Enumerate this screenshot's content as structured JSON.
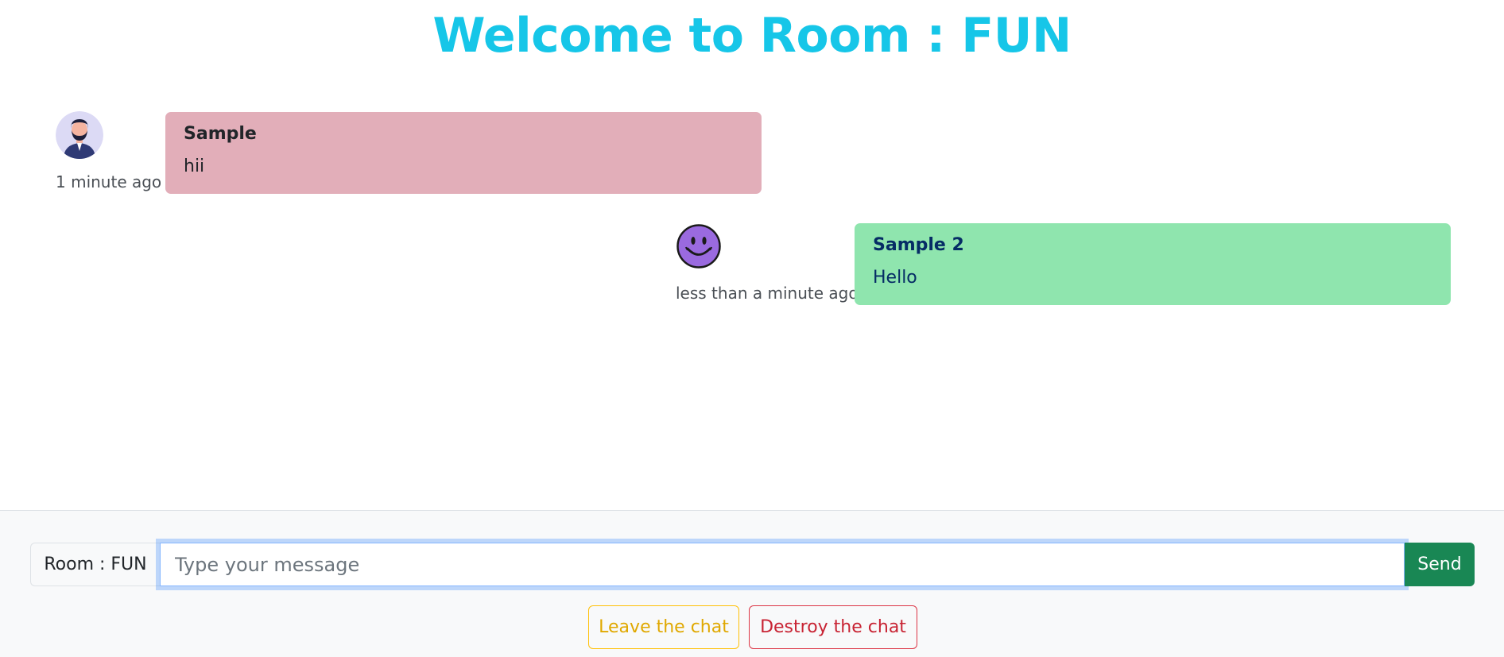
{
  "header": {
    "title": "Welcome to Room : FUN"
  },
  "messages": [
    {
      "sender": "Sample",
      "text": "hii",
      "time": "1 minute ago",
      "avatar": "man-avatar-icon",
      "bubble_color": "#e2aeb9",
      "sender_color": "#212529",
      "text_color": "#212529"
    },
    {
      "sender": "Sample 2",
      "text": "Hello",
      "time": "less than a minute ago",
      "avatar": "smiley-avatar-icon",
      "bubble_color": "#8fe5ae",
      "sender_color": "#052c65",
      "text_color": "#052c65"
    }
  ],
  "composer": {
    "room_label": "Room : FUN",
    "placeholder": "Type your message",
    "value": "",
    "send_label": "Send"
  },
  "actions": {
    "leave_label": "Leave the chat",
    "destroy_label": "Destroy the chat"
  },
  "colors": {
    "title": "#16c6e8",
    "send": "#198754",
    "leave": "#ffc107",
    "destroy": "#dc3545"
  }
}
